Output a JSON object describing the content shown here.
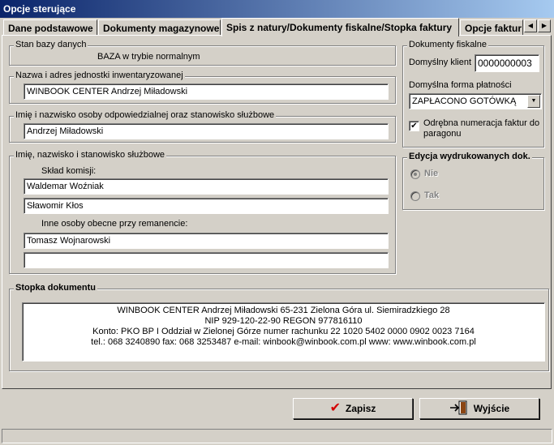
{
  "window": {
    "title": "Opcje sterujące"
  },
  "tabs": [
    {
      "label": "Dane podstawowe"
    },
    {
      "label": "Dokumenty magazynowe"
    },
    {
      "label": "Spis z natury/Dokumenty fiskalne/Stopka faktury"
    },
    {
      "label": "Opcje faktur"
    }
  ],
  "db_state": {
    "legend": "Stan bazy danych",
    "value": "BAZA w trybie normalnym"
  },
  "unit_name": {
    "legend": "Nazwa i adres jednostki inwentaryzowanej",
    "value": "WINBOOK CENTER Andrzej Miładowski"
  },
  "responsible": {
    "legend": "Imię i nazwisko osoby odpowiedzialnej oraz stanowisko służbowe",
    "value": "Andrzej Miładowski"
  },
  "commission": {
    "legend": "Imię, nazwisko i stanowisko służbowe",
    "members_label": "Skład komisji:",
    "members": [
      "Waldemar Woźniak",
      "Sławomir Kłos"
    ],
    "others_label": "Inne osoby obecne przy remanencie:",
    "others": [
      "Tomasz Wojnarowski",
      ""
    ]
  },
  "fiscal": {
    "legend": "Dokumenty fiskalne",
    "client_label": "Domyślny klient",
    "client_value": "0000000003",
    "payment_label": "Domyślna forma płatności",
    "payment_value": "ZAPŁACONO GOTÓWKĄ",
    "separate_numbering_label": "Odrębna numeracja faktur do paragonu",
    "separate_numbering_checked": "✔"
  },
  "printed_edit": {
    "legend": "Edycja wydrukowanych dok.",
    "option_no": "Nie",
    "option_yes": "Tak"
  },
  "footer": {
    "legend": "Stopka dokumentu",
    "lines": [
      "WINBOOK CENTER Andrzej Miładowski     65-231 Zielona Góra    ul. Siemiradzkiego 28",
      "NIP 929-120-22-90     REGON 977816110",
      "Konto: PKO BP I Oddział w Zielonej Górze       numer rachunku  22 1020 5402 0000 0902 0023 7164",
      "tel.: 068 3240890  fax: 068 3253487  e-mail: winbook@winbook.com.pl   www: www.winbook.com.pl"
    ]
  },
  "buttons": {
    "save": "Zapisz",
    "exit": "Wyjście"
  },
  "icons": {
    "save": "checkmark-icon",
    "exit": "exit-door-icon",
    "combo": "chevron-down-icon",
    "scroll_left": "arrow-left-icon",
    "scroll_right": "arrow-right-icon"
  },
  "colors": {
    "title_start": "#0a246a",
    "title_end": "#a6caf0",
    "save_check": "#d40000"
  }
}
